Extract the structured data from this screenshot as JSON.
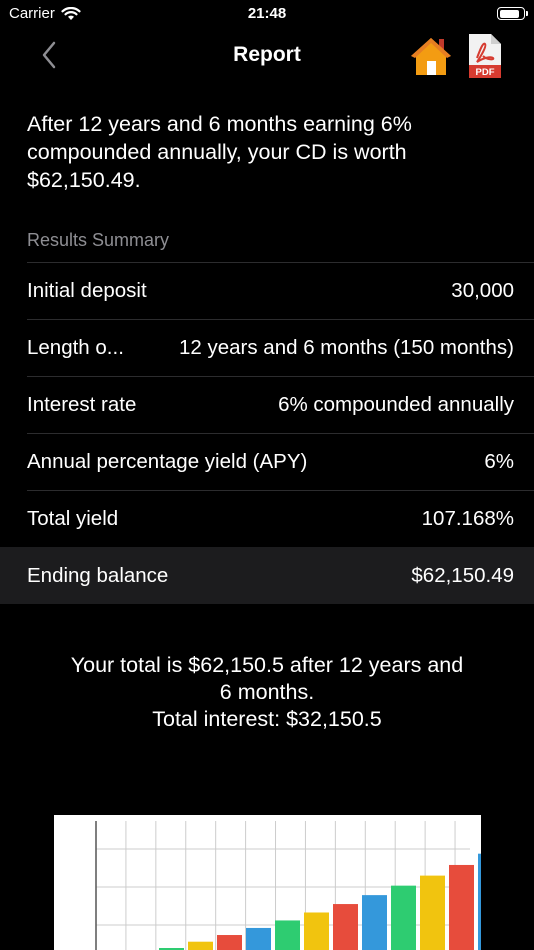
{
  "status_bar": {
    "carrier": "Carrier",
    "time": "21:48",
    "battery_level": 0.9
  },
  "nav": {
    "title": "Report",
    "back_icon": "chevron-left-icon",
    "home_icon": "home-icon",
    "pdf_icon": "pdf-icon",
    "pdf_label": "PDF"
  },
  "summary": {
    "text": "After 12 years and 6 months earning 6% compounded annually, your CD is worth $62,150.49."
  },
  "results": {
    "header": "Results Summary",
    "rows": [
      {
        "label": "Initial deposit",
        "value": "30,000"
      },
      {
        "label": "Length o...",
        "value": "12 years and 6 months (150 months)"
      },
      {
        "label": "Interest rate",
        "value": "6% compounded annually"
      },
      {
        "label": "Annual percentage yield (APY)",
        "value": "6%"
      },
      {
        "label": "Total yield",
        "value": "107.168%"
      },
      {
        "label": "Ending balance",
        "value": "$62,150.49"
      }
    ]
  },
  "total": {
    "line1": "Your total is $62,150.5 after 12 years and",
    "line2": "6 months.",
    "line3": "Total interest: $32,150.5"
  },
  "colors": {
    "green": "#2ecc71",
    "yellow": "#f1c40f",
    "red": "#e74c3c",
    "blue": "#3498db"
  },
  "chart_data": {
    "type": "bar",
    "values": [
      30000,
      31800,
      33708,
      35730,
      37874,
      40147,
      42556,
      45109,
      47815,
      50684,
      53725,
      56949,
      60366
    ],
    "ylim": [
      30000,
      62000
    ],
    "colors": [
      "#2ecc71",
      "#f1c40f",
      "#e74c3c",
      "#3498db"
    ]
  }
}
